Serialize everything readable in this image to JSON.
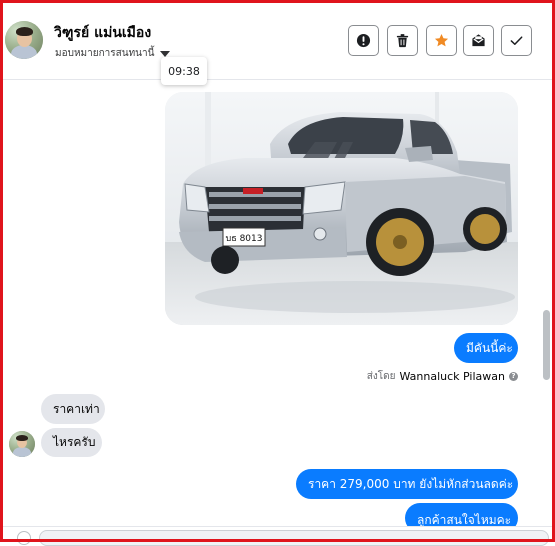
{
  "contact": {
    "name": "วิฑูรย์ แม่นเมือง",
    "assign_label": "มอบหมายการสนทนานี้"
  },
  "toolbar": {
    "buttons": [
      "alert-icon",
      "trash-icon",
      "star-icon",
      "mail-icon",
      "check-icon"
    ],
    "star_color": "#f08a24"
  },
  "tooltip": {
    "time": "09:38"
  },
  "messages": {
    "outgoing_1": "มีคันนี้ค่ะ",
    "sent_by_prefix": "ส่งโดย",
    "sent_by_name": "Wannaluck Pilawan",
    "incoming_1": "ราคาเท่า",
    "incoming_2": "ไหรครับ",
    "outgoing_2": "ราคา 279,000 บาท  ยังไม่หักส่วนลดค่ะ",
    "outgoing_3": "ลูกค้าสนใจไหมคะ"
  },
  "photo": {
    "plate_text": "บธ 8013"
  },
  "colors": {
    "accent": "#0a7cff",
    "frame": "#e0141c"
  }
}
